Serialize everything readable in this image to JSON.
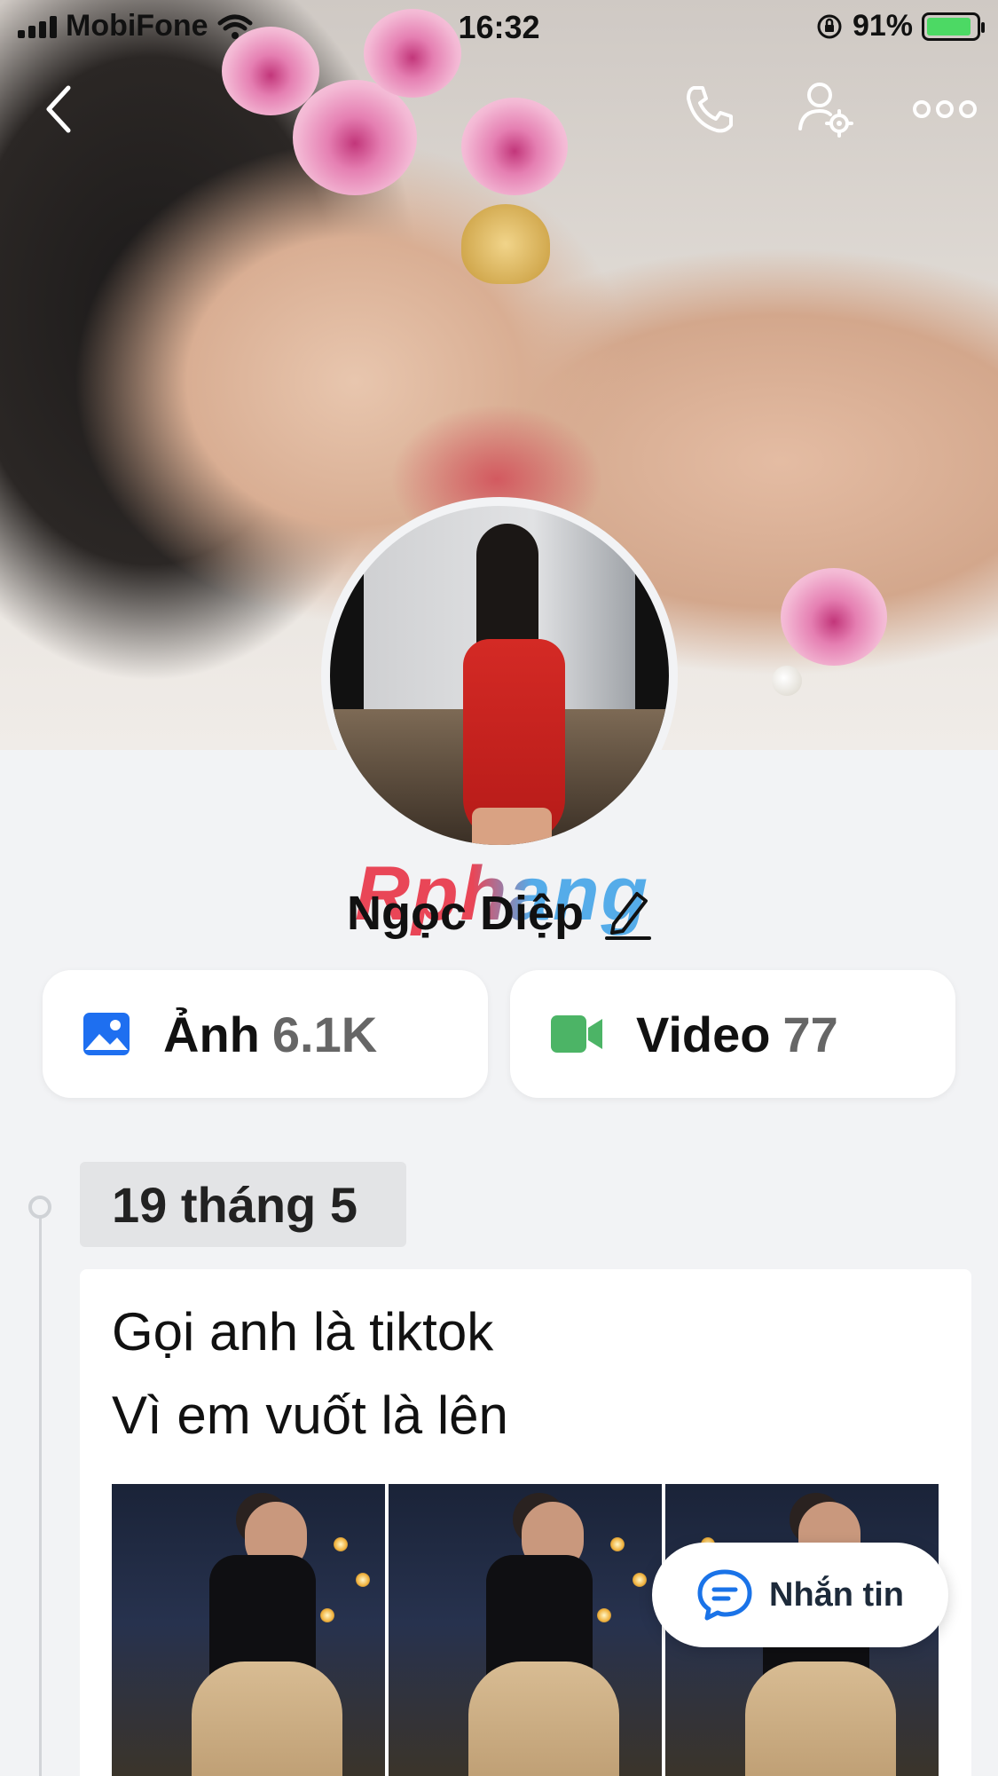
{
  "status_bar": {
    "carrier": "MobiFone",
    "time": "16:32",
    "battery_percent": "91%"
  },
  "profile": {
    "name": "Ngọc Diệp",
    "watermark_text": "Rphang"
  },
  "stats": {
    "photos": {
      "label": "Ảnh",
      "count": "6.1K"
    },
    "videos": {
      "label": "Video",
      "count": "77"
    }
  },
  "timeline": {
    "date": "19 tháng 5",
    "post": {
      "line1": "Gọi anh là tiktok",
      "line2": "Vì em vuốt là lên"
    }
  },
  "fab": {
    "label": "Nhắn tin"
  },
  "colors": {
    "photo_icon": "#1e6ff0",
    "video_icon": "#4cb466",
    "message_icon": "#1a73e8",
    "background": "#f2f3f5"
  },
  "icons": {
    "back": "chevron-left-icon",
    "call": "phone-icon",
    "settings": "user-settings-icon",
    "more": "more-horizontal-icon",
    "edit": "pencil-icon",
    "photo": "image-icon",
    "video": "video-camera-icon",
    "message": "chat-bubble-icon"
  }
}
